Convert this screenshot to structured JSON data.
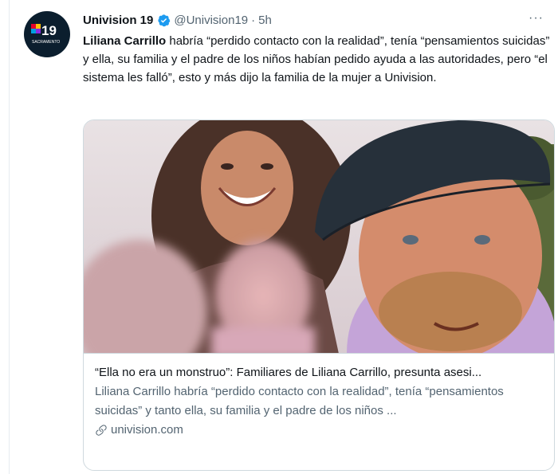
{
  "tweet": {
    "account_name": "Univision 19",
    "handle": "@Univision19",
    "separator": "·",
    "time": "5h",
    "more": "···",
    "avatar_logo_text": "19",
    "avatar_logo_subtext": "SACRAMENTO",
    "text_bold": "Liliana Carrillo",
    "text_rest": " habría “perdido contacto con la realidad”, tenía “pensamientos suicidas” y ella, su familia y el padre de los niños habían pedido ayuda a las autoridades, pero “el sistema les falló”, esto y más dijo la familia de la mujer a Univision."
  },
  "card": {
    "title": "“Ella no era un monstruo”: Familiares de Liliana Carrillo, presunta asesi...",
    "description": "Liliana Carrillo habría “perdido contacto con la realidad”, tenía “pensamientos suicidas” y tanto ella, su familia y el padre de los niños ...",
    "domain": "univision.com"
  },
  "colors": {
    "verified": "#1d9bf0",
    "secondary_text": "#536471",
    "border": "#cfd9de",
    "avatar_bg": "#0b1e2e"
  },
  "icons": [
    "verified-badge-icon",
    "more-icon",
    "link-icon"
  ]
}
